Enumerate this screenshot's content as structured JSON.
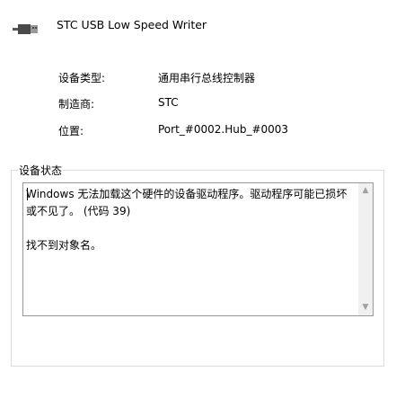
{
  "device": {
    "name": "STC USB Low Speed Writer",
    "icon": "usb-plug-icon"
  },
  "properties": [
    {
      "label": "设备类型:",
      "value": "通用串行总线控制器"
    },
    {
      "label": "制造商:",
      "value": "STC"
    },
    {
      "label": "位置:",
      "value": "Port_#0002.Hub_#0003"
    }
  ],
  "status_group": {
    "title": "设备状态",
    "text": "Windows 无法加载这个硬件的设备驱动程序。驱动程序可能已损坏或不见了。 (代码 39)\n\n找不到对象名。"
  },
  "colors": {
    "textbox_border": "#7a9cc8",
    "group_border": "#dcdcdc",
    "scrollbar_track": "#f0f0f0",
    "scroll_arrow": "#a0a0a0"
  }
}
